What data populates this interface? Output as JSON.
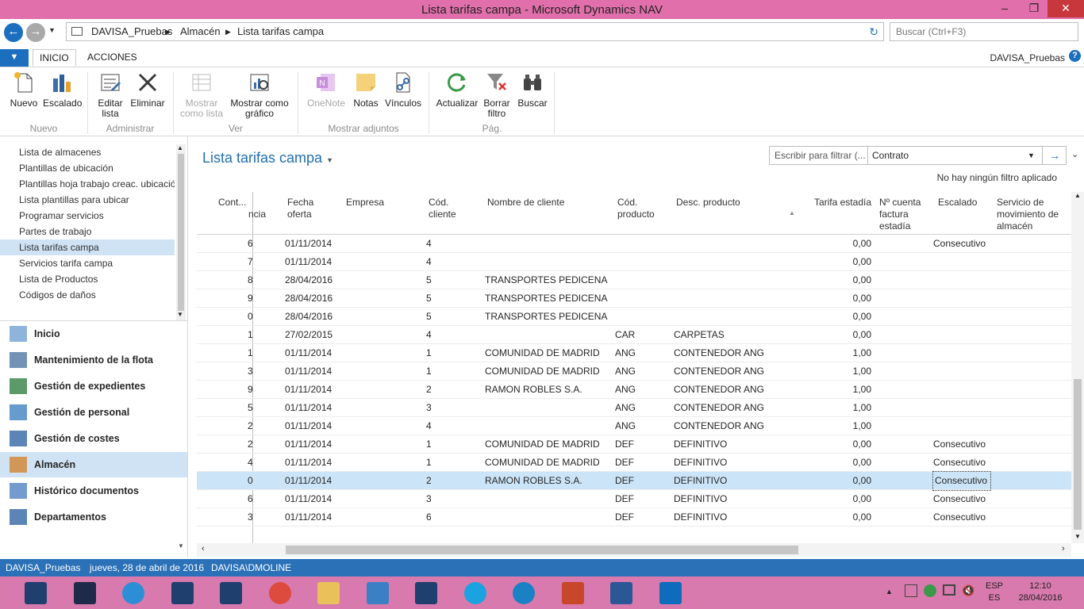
{
  "window": {
    "title": "Lista tarifas campa - Microsoft Dynamics NAV",
    "minimize": "–",
    "restore": "❐",
    "close": "✕"
  },
  "address": {
    "crumbs": [
      "DAVISA_Pruebas",
      "Almacén",
      "Lista tarifas campa"
    ],
    "search_placeholder": "Buscar (Ctrl+F3)"
  },
  "ribbon_tabs": {
    "inicio": "INICIO",
    "acciones": "ACCIONES",
    "company": "DAVISA_Pruebas"
  },
  "ribbon": {
    "nuevo": "Nuevo",
    "escalado": "Escalado",
    "editar_lista": "Editar lista",
    "eliminar": "Eliminar",
    "mostrar_lista": "Mostrar como lista",
    "mostrar_grafico": "Mostrar como gráfico",
    "onenote": "OneNote",
    "notas": "Notas",
    "vinculos": "Vínculos",
    "actualizar": "Actualizar",
    "borrar_filtro": "Borrar filtro",
    "buscar": "Buscar",
    "groups": {
      "nuevo": "Nuevo",
      "administrar": "Administrar",
      "ver": "Ver",
      "adjuntos": "Mostrar adjuntos",
      "pag": "Pág."
    }
  },
  "nav_links": [
    "Lista de almacenes",
    "Plantillas de ubicación",
    "Plantillas hoja trabajo creac. ubicación",
    "Lista plantillas para ubicar",
    "Programar servicios",
    "Partes de trabajo",
    "Lista tarifas campa",
    "Servicios tarifa campa",
    "Lista de Productos",
    "Códigos de daños"
  ],
  "areas": [
    "Inicio",
    "Mantenimiento de la flota",
    "Gestión de expedientes",
    "Gestión de personal",
    "Gestión de costes",
    "Almacén",
    "Histórico documentos",
    "Departamentos"
  ],
  "page": {
    "title": "Lista tarifas campa",
    "filter_placeholder": "Escribir para filtrar (...",
    "filter_field": "Contrato",
    "no_filter": "No hay ningún filtro aplicado"
  },
  "columns": {
    "cont": "Cont...",
    "ref": "ncia",
    "fecha": "Fecha oferta",
    "empresa": "Empresa",
    "cod_cliente": "Cód. cliente",
    "nombre": "Nombre de cliente",
    "cod_producto": "Cód. producto",
    "desc_producto": "Desc. producto",
    "tarifa": "Tarifa estadía",
    "cuenta": "Nº cuenta factura estadía",
    "escalado": "Escalado",
    "servicio": "Servicio de movimiento de almacén"
  },
  "rows": [
    {
      "ref": "6",
      "fecha": "01/11/2014",
      "cliente": "4",
      "nombre": "",
      "cod": "",
      "desc": "",
      "tarifa": "0,00",
      "escalado": "Consecutivo"
    },
    {
      "ref": "7",
      "fecha": "01/11/2014",
      "cliente": "4",
      "nombre": "",
      "cod": "",
      "desc": "",
      "tarifa": "0,00",
      "escalado": ""
    },
    {
      "ref": "8",
      "fecha": "28/04/2016",
      "cliente": "5",
      "nombre": "TRANSPORTES PEDICENA",
      "cod": "",
      "desc": "",
      "tarifa": "0,00",
      "escalado": ""
    },
    {
      "ref": "9",
      "fecha": "28/04/2016",
      "cliente": "5",
      "nombre": "TRANSPORTES PEDICENA",
      "cod": "",
      "desc": "",
      "tarifa": "0,00",
      "escalado": ""
    },
    {
      "ref": "0",
      "fecha": "28/04/2016",
      "cliente": "5",
      "nombre": "TRANSPORTES PEDICENA",
      "cod": "",
      "desc": "",
      "tarifa": "0,00",
      "escalado": ""
    },
    {
      "ref": "1",
      "fecha": "27/02/2015",
      "cliente": "4",
      "nombre": "",
      "cod": "CAR",
      "desc": "CARPETAS",
      "tarifa": "0,00",
      "escalado": ""
    },
    {
      "ref": "1",
      "fecha": "01/11/2014",
      "cliente": "1",
      "nombre": "COMUNIDAD DE MADRID",
      "cod": "ANG",
      "desc": "CONTENEDOR ANG",
      "tarifa": "1,00",
      "escalado": ""
    },
    {
      "ref": "3",
      "fecha": "01/11/2014",
      "cliente": "1",
      "nombre": "COMUNIDAD DE MADRID",
      "cod": "ANG",
      "desc": "CONTENEDOR ANG",
      "tarifa": "1,00",
      "escalado": ""
    },
    {
      "ref": "9",
      "fecha": "01/11/2014",
      "cliente": "2",
      "nombre": "RAMON ROBLES S.A.",
      "cod": "ANG",
      "desc": "CONTENEDOR ANG",
      "tarifa": "1,00",
      "escalado": ""
    },
    {
      "ref": "5",
      "fecha": "01/11/2014",
      "cliente": "3",
      "nombre": "",
      "cod": "ANG",
      "desc": "CONTENEDOR ANG",
      "tarifa": "1,00",
      "escalado": ""
    },
    {
      "ref": "2",
      "fecha": "01/11/2014",
      "cliente": "4",
      "nombre": "",
      "cod": "ANG",
      "desc": "CONTENEDOR ANG",
      "tarifa": "1,00",
      "escalado": ""
    },
    {
      "ref": "2",
      "fecha": "01/11/2014",
      "cliente": "1",
      "nombre": "COMUNIDAD DE MADRID",
      "cod": "DEF",
      "desc": "DEFINITIVO",
      "tarifa": "0,00",
      "escalado": "Consecutivo"
    },
    {
      "ref": "4",
      "fecha": "01/11/2014",
      "cliente": "1",
      "nombre": "COMUNIDAD DE MADRID",
      "cod": "DEF",
      "desc": "DEFINITIVO",
      "tarifa": "0,00",
      "escalado": "Consecutivo"
    },
    {
      "ref": "0",
      "fecha": "01/11/2014",
      "cliente": "2",
      "nombre": "RAMON ROBLES S.A.",
      "cod": "DEF",
      "desc": "DEFINITIVO",
      "tarifa": "0,00",
      "escalado": "Consecutivo"
    },
    {
      "ref": "6",
      "fecha": "01/11/2014",
      "cliente": "3",
      "nombre": "",
      "cod": "DEF",
      "desc": "DEFINITIVO",
      "tarifa": "0,00",
      "escalado": "Consecutivo"
    },
    {
      "ref": "3",
      "fecha": "01/11/2014",
      "cliente": "6",
      "nombre": "",
      "cod": "DEF",
      "desc": "DEFINITIVO",
      "tarifa": "0,00",
      "escalado": "Consecutivo"
    }
  ],
  "selected_row": 13,
  "status": {
    "company": "DAVISA_Pruebas",
    "date": "jueves, 28 de abril de 2016",
    "user": "DAVISA\\DMOLINE"
  },
  "tray": {
    "lang1": "ESP",
    "lang2": "ES",
    "time": "12:10",
    "date": "28/04/2016"
  },
  "taskbar_icons": [
    "dynamics-nav",
    "photoshop",
    "internet-explorer",
    "dynamics-nav",
    "dynamics-nav",
    "chrome",
    "file-explorer",
    "remote-desktop",
    "dynamics-nav",
    "skype",
    "skype-business",
    "powerpoint",
    "word",
    "outlook"
  ],
  "colors": {
    "titlebar": "#e06fab",
    "accent": "#1f6fb2",
    "selection": "#cce4f7",
    "statusbar": "#2a71b8",
    "taskbar": "#d87aad"
  }
}
